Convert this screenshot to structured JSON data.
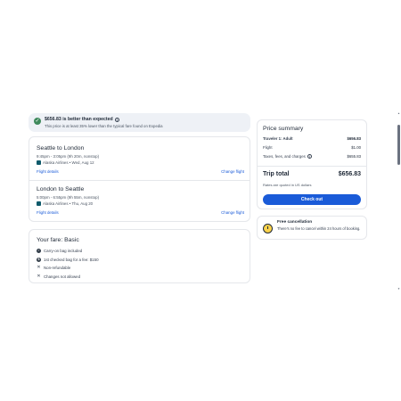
{
  "banner": {
    "title": "$656.83 is better than expected",
    "subtitle": "This price is at least 35% lower than the typical fare found on Expedia"
  },
  "flights": [
    {
      "title": "Seattle to London",
      "times": "9:45pm - 3:05pm (9h 20m, nonstop)",
      "airline": "Alaska Airlines • Wed, Aug 12",
      "details_link": "Flight details",
      "change_link": "Change flight"
    },
    {
      "title": "London to Seattle",
      "times": "5:00pm - 6:55pm (9h 55m, nonstop)",
      "airline": "Alaska Airlines • Thu, Aug 20",
      "details_link": "Flight details",
      "change_link": "Change flight"
    }
  ],
  "fare": {
    "heading": "Your fare: Basic",
    "items": [
      {
        "text": "Carry-on bag included",
        "icon": "check-icon"
      },
      {
        "text": "1st checked bag for a fee: $150",
        "icon": "dollar-icon"
      },
      {
        "text": "Non-refundable",
        "icon": "x-icon"
      },
      {
        "text": "Changes not allowed",
        "icon": "x-icon"
      }
    ]
  },
  "price": {
    "title": "Price summary",
    "rows": [
      {
        "label": "Traveler 1: Adult",
        "value": "$656.83"
      },
      {
        "label": "Flight",
        "value": "$1.00"
      },
      {
        "label": "Taxes, fees, and charges",
        "value": "$655.83"
      }
    ],
    "total_label": "Trip total",
    "total_value": "$656.83",
    "note": "Rates are quoted in US dollars",
    "checkout": "Check out"
  },
  "cancellation": {
    "title": "Free cancellation",
    "text": "There's no fee to cancel within 24 hours of booking."
  },
  "colors": {
    "accent": "#1a5bd8",
    "banner_bg": "#eef1f6",
    "success": "#3f8a5c"
  }
}
